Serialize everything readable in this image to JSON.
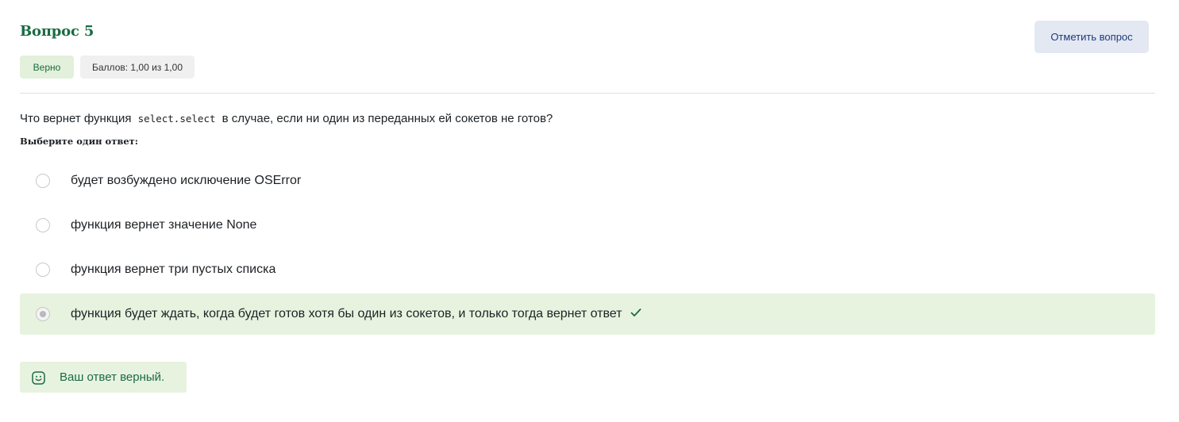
{
  "question": {
    "title": "Вопрос 5",
    "flag_button": "Отметить вопрос",
    "status_badge": "Верно",
    "score_badge": "Баллов: 1,00 из 1,00",
    "text_before": "Что вернет функция",
    "code": "select.select",
    "text_after": "в случае, если ни один из переданных ей сокетов не готов?",
    "prompt": "Выберите один ответ:"
  },
  "options": [
    {
      "label": "будет возбуждено исключение OSError",
      "selected": false
    },
    {
      "label": "функция вернет значение None",
      "selected": false
    },
    {
      "label": "функция вернет три пустых списка",
      "selected": false
    },
    {
      "label": "функция будет ждать, когда будет готов хотя бы один из сокетов, и только тогда вернет ответ",
      "selected": true,
      "correct": true
    }
  ],
  "feedback": {
    "text": "Ваш ответ верный.",
    "icon": "smile-icon"
  },
  "colors": {
    "title": "#1a6b44",
    "correct_bg": "#e8f3df",
    "flag_bg": "#e3e8f3",
    "flag_text": "#1f3a7a"
  }
}
